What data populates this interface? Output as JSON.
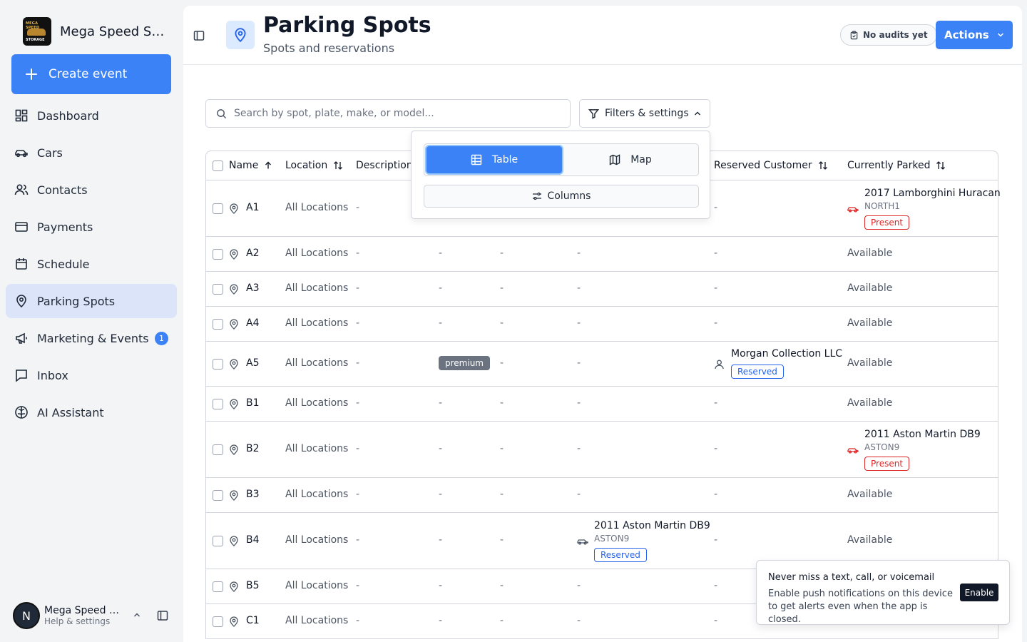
{
  "brand": {
    "name": "Mega Speed St...",
    "logo_text_top": "MEGA SPEED",
    "logo_text_bottom": "STORAGE"
  },
  "sidebar": {
    "create_label": "Create event",
    "items": [
      {
        "label": "Dashboard",
        "icon": "dashboard-icon"
      },
      {
        "label": "Cars",
        "icon": "car-icon"
      },
      {
        "label": "Contacts",
        "icon": "users-icon"
      },
      {
        "label": "Payments",
        "icon": "credit-card-icon"
      },
      {
        "label": "Schedule",
        "icon": "calendar-icon"
      },
      {
        "label": "Parking Spots",
        "icon": "map-pin-icon",
        "active": true
      },
      {
        "label": "Marketing & Events",
        "icon": "megaphone-icon",
        "badge": "1"
      },
      {
        "label": "Inbox",
        "icon": "inbox-icon"
      },
      {
        "label": "AI Assistant",
        "icon": "brain-icon"
      }
    ],
    "user": {
      "initial": "N",
      "name": "Mega Speed St...",
      "sub": "Help & settings"
    }
  },
  "header": {
    "title": "Parking Spots",
    "subtitle": "Spots and reservations",
    "audit_label": "No audits yet",
    "actions_label": "Actions"
  },
  "toolbar": {
    "search_placeholder": "Search by spot, plate, make, or model...",
    "filters_label": "Filters & settings"
  },
  "popover": {
    "table_label": "Table",
    "map_label": "Map",
    "columns_label": "Columns"
  },
  "table": {
    "columns": [
      "Name",
      "Location",
      "Description",
      "Reserved Customer",
      "Currently Parked"
    ],
    "rows": [
      {
        "name": "A1",
        "location": "All Locations",
        "description": "-",
        "tags": "-",
        "c5": "-",
        "reserved_car": null,
        "customer": null,
        "parked": {
          "title": "2017 Lamborghini Huracan",
          "plate": "NORTH1",
          "status": "Present"
        }
      },
      {
        "name": "A2",
        "location": "All Locations",
        "description": "-",
        "tags": "-",
        "c5": "-",
        "c6": "-",
        "customer_text": "-",
        "parked_text": "Available"
      },
      {
        "name": "A3",
        "location": "All Locations",
        "description": "-",
        "tags": "-",
        "c5": "-",
        "c6": "-",
        "customer_text": "-",
        "parked_text": "Available"
      },
      {
        "name": "A4",
        "location": "All Locations",
        "description": "-",
        "tags": "-",
        "c5": "-",
        "c6": "-",
        "customer_text": "-",
        "parked_text": "Available"
      },
      {
        "name": "A5",
        "location": "All Locations",
        "description": "-",
        "tag_label": "premium",
        "c5": "-",
        "c6": "-",
        "customer": {
          "name": "Morgan Collection LLC",
          "status": "Reserved"
        },
        "parked_text": "Available"
      },
      {
        "name": "B1",
        "location": "All Locations",
        "description": "-",
        "tags": "-",
        "c5": "-",
        "c6": "-",
        "customer_text": "-",
        "parked_text": "Available"
      },
      {
        "name": "B2",
        "location": "All Locations",
        "description": "-",
        "tags": "-",
        "c5": "-",
        "c6": "-",
        "customer_text": "-",
        "parked": {
          "title": "2011 Aston Martin DB9",
          "plate": "ASTON9",
          "status": "Present"
        }
      },
      {
        "name": "B3",
        "location": "All Locations",
        "description": "-",
        "tags": "-",
        "c5": "-",
        "c6": "-",
        "customer_text": "-",
        "parked_text": "Available"
      },
      {
        "name": "B4",
        "location": "All Locations",
        "description": "-",
        "tags": "-",
        "c5": "-",
        "reserved_car": {
          "title": "2011 Aston Martin DB9",
          "plate": "ASTON9",
          "status": "Reserved"
        },
        "customer_text": "-",
        "parked_text": "Available"
      },
      {
        "name": "B5",
        "location": "All Locations",
        "description": "-",
        "tags": "-",
        "c5": "-",
        "c6": "-",
        "customer_text": "-",
        "parked_text": ""
      },
      {
        "name": "C1",
        "location": "All Locations",
        "description": "-",
        "tags": "-",
        "c5": "-",
        "c6": "-",
        "customer_text": "-",
        "parked_text": ""
      }
    ]
  },
  "toast": {
    "title": "Never miss a text, call, or voicemail",
    "body": "Enable push notifications on this device to get alerts even when the app is closed.",
    "button": "Enable"
  },
  "colors": {
    "accent": "#3b82f6",
    "present": "#dc2626",
    "reserved": "#2563eb",
    "active_nav": "#dbe4f8"
  }
}
